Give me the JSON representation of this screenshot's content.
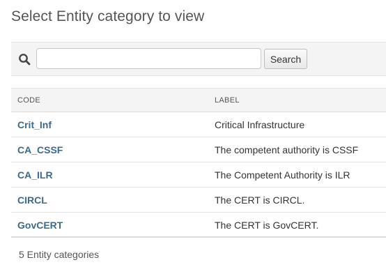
{
  "page": {
    "title": "Select Entity category to view"
  },
  "search": {
    "icon": "search-icon",
    "value": "",
    "placeholder": "",
    "button_label": "Search"
  },
  "table": {
    "columns": [
      "CODE",
      "LABEL"
    ],
    "rows": [
      {
        "code": "Crit_Inf",
        "label": "Critical Infrastructure"
      },
      {
        "code": "CA_CSSF",
        "label": "The competent authority is CSSF"
      },
      {
        "code": "CA_ILR",
        "label": "The Competent Authority is ILR"
      },
      {
        "code": "CIRCL",
        "label": "The CERT is CIRCL."
      },
      {
        "code": "GovCERT",
        "label": "The CERT is GovCERT."
      }
    ]
  },
  "footer": {
    "count_text": "5 Entity categories"
  },
  "colors": {
    "link": "#3a6b8c",
    "header_bg": "#f4f4f4"
  }
}
